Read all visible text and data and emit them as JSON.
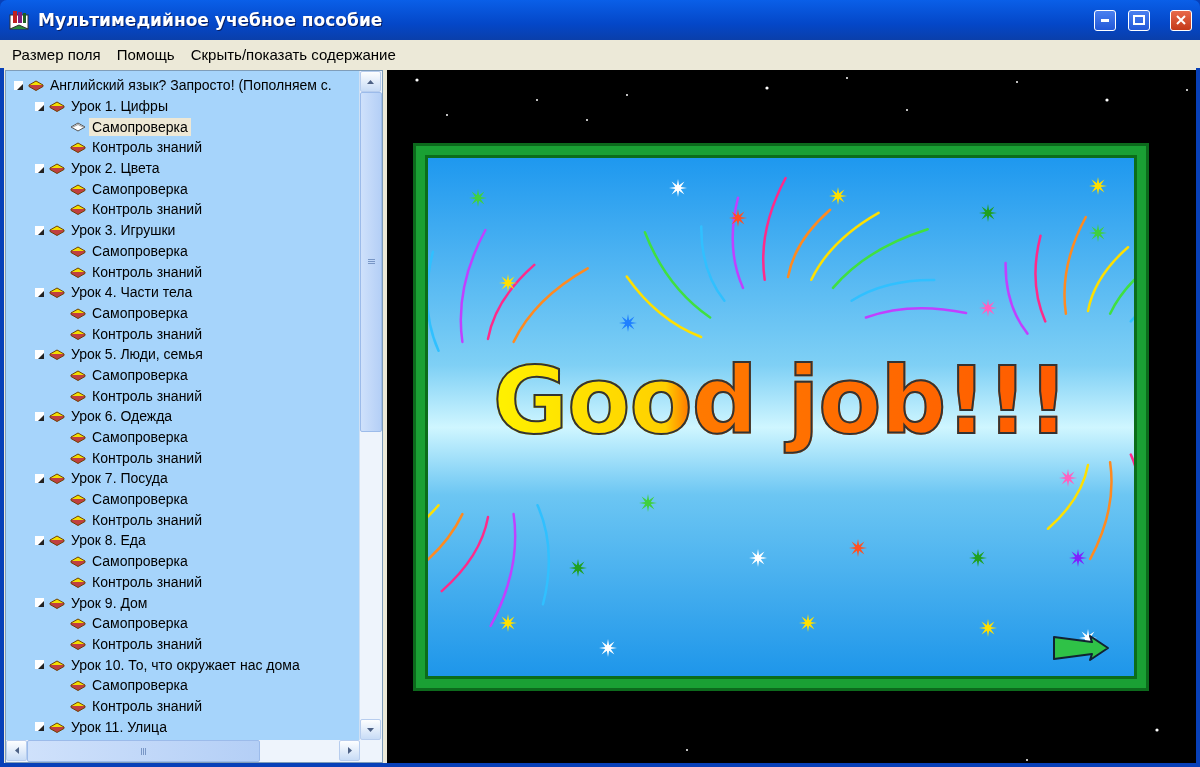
{
  "window": {
    "title": "Мультимедийное учебное пособие"
  },
  "menu": [
    {
      "label": "Размер поля"
    },
    {
      "label": "Помощь"
    },
    {
      "label": "Скрыть/показать содержание"
    }
  ],
  "tree": [
    {
      "label": "Английский язык? Запросто! (Пополняем с.",
      "expanded": true,
      "selected": false,
      "children": [
        {
          "label": "Урок 1. Цифры",
          "expanded": true,
          "selected": false,
          "children": [
            {
              "label": "Самопроверка",
              "selected": true
            },
            {
              "label": "Контроль знаний",
              "selected": false
            }
          ]
        },
        {
          "label": "Урок 2. Цвета",
          "expanded": true,
          "selected": false,
          "children": [
            {
              "label": "Самопроверка",
              "selected": false
            },
            {
              "label": "Контроль знаний",
              "selected": false
            }
          ]
        },
        {
          "label": "Урок 3. Игрушки",
          "expanded": true,
          "selected": false,
          "children": [
            {
              "label": "Самопроверка",
              "selected": false
            },
            {
              "label": "Контроль знаний",
              "selected": false
            }
          ]
        },
        {
          "label": "Урок 4. Части тела",
          "expanded": true,
          "selected": false,
          "children": [
            {
              "label": "Самопроверка",
              "selected": false
            },
            {
              "label": "Контроль знаний",
              "selected": false
            }
          ]
        },
        {
          "label": "Урок 5. Люди, семья",
          "expanded": true,
          "selected": false,
          "children": [
            {
              "label": "Самопроверка",
              "selected": false
            },
            {
              "label": "Контроль знаний",
              "selected": false
            }
          ]
        },
        {
          "label": "Урок 6. Одежда",
          "expanded": true,
          "selected": false,
          "children": [
            {
              "label": "Самопроверка",
              "selected": false
            },
            {
              "label": "Контроль знаний",
              "selected": false
            }
          ]
        },
        {
          "label": "Урок 7. Посуда",
          "expanded": true,
          "selected": false,
          "children": [
            {
              "label": "Самопроверка",
              "selected": false
            },
            {
              "label": "Контроль знаний",
              "selected": false
            }
          ]
        },
        {
          "label": "Урок 8. Еда",
          "expanded": true,
          "selected": false,
          "children": [
            {
              "label": "Самопроверка",
              "selected": false
            },
            {
              "label": "Контроль знаний",
              "selected": false
            }
          ]
        },
        {
          "label": "Урок 9. Дом",
          "expanded": true,
          "selected": false,
          "children": [
            {
              "label": "Самопроверка",
              "selected": false
            },
            {
              "label": "Контроль знаний",
              "selected": false
            }
          ]
        },
        {
          "label": "Урок 10. То, что окружает нас дома",
          "expanded": true,
          "selected": false,
          "children": [
            {
              "label": "Самопроверка",
              "selected": false
            },
            {
              "label": "Контроль знаний",
              "selected": false
            }
          ]
        },
        {
          "label": "Урок 11. Улица",
          "expanded": true,
          "selected": false
        }
      ]
    }
  ],
  "slide": {
    "headline": "Good job!!!"
  }
}
